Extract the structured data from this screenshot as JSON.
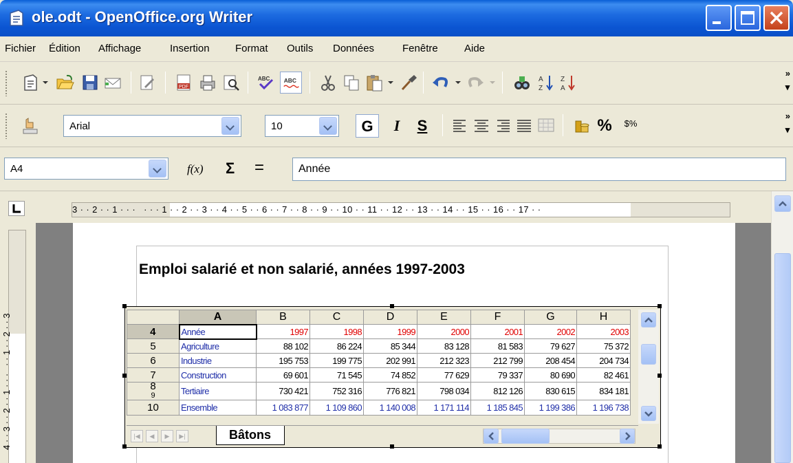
{
  "window": {
    "title": "ole.odt - OpenOffice.org Writer"
  },
  "menu": [
    "Fichier",
    "Édition",
    "Affichage",
    "Insertion",
    "Format",
    "Outils",
    "Données",
    "Fenêtre",
    "Aide"
  ],
  "format_toolbar": {
    "font_name": "Arial",
    "font_size": "10",
    "bold": "G",
    "italic": "I",
    "underline": "S",
    "percent": "%",
    "currency": "$%"
  },
  "formula_bar": {
    "cell_ref": "A4",
    "fx": "f(x)",
    "sum": "Σ",
    "equals": "=",
    "content": "Année"
  },
  "ruler": {
    "text": "3 · · 2 · · 1 · · ·   · · · 1 · · 2 · · 3 · · 4 · · 5 · · 6 · · 7 · · 8 · · 9 · · 10 · · 11 · · 12 · · 13 · · 14 · · 15 · · 16 · · 17 · ·"
  },
  "vertical_ruler": {
    "text": "4 · · 3 · · 2 · · 1 · · ·   · · 1 · · 2 · · 3"
  },
  "document": {
    "heading": "Emploi salarié et non salarié, années 1997-2003"
  },
  "spreadsheet": {
    "columns": [
      "A",
      "B",
      "C",
      "D",
      "E",
      "F",
      "G",
      "H"
    ],
    "rows": [
      {
        "num": "4",
        "cells": [
          "Année",
          "1997",
          "1998",
          "1999",
          "2000",
          "2001",
          "2002",
          "2003"
        ]
      },
      {
        "num": "5",
        "cells": [
          "Agriculture",
          "88 102",
          "86 224",
          "85 344",
          "83 128",
          "81 583",
          "79 627",
          "75 372"
        ]
      },
      {
        "num": "6",
        "cells": [
          "Industrie",
          "195 753",
          "199 775",
          "202 991",
          "212 323",
          "212 799",
          "208 454",
          "204 734"
        ]
      },
      {
        "num": "7",
        "cells": [
          "Construction",
          "69 601",
          "71 545",
          "74 852",
          "77 629",
          "79 337",
          "80 690",
          "82 461"
        ]
      },
      {
        "num": "8",
        "cells": [
          "Tertiaire",
          "730 421",
          "752 316",
          "776 821",
          "798 034",
          "812 126",
          "830 615",
          "834 181"
        ]
      },
      {
        "num": "10",
        "cells": [
          "Ensemble",
          "1 083 877",
          "1 109 860",
          "1 140 008",
          "1 171 114",
          "1 185 845",
          "1 199 386",
          "1 196 738"
        ]
      }
    ],
    "hidden_row_label": "9",
    "sheet_tab": "Bâtons",
    "colors": {
      "label": "#1f2ea8",
      "year": "#e00000"
    }
  }
}
